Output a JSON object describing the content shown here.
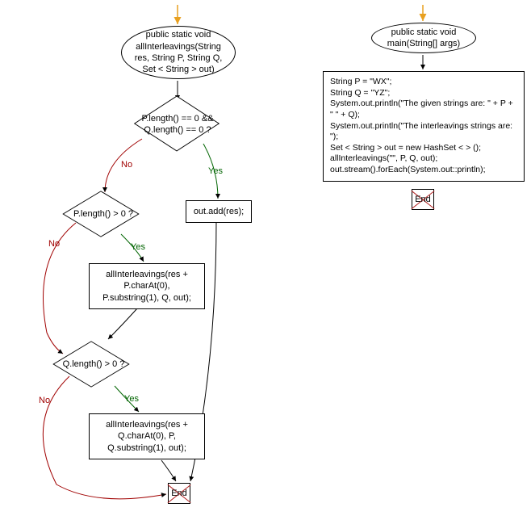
{
  "flow": {
    "func1_sig": "public static void\nallInterleavings(String\nres, String P, String Q,\nSet < String > out)",
    "cond1": "P.length() == 0 &&\nQ.length() == 0 ?",
    "cond2": "P.length() > 0 ?",
    "cond3": "Q.length() > 0 ?",
    "stmt_add": "out.add(res);",
    "rec1": "allInterleavings(res +\nP.charAt(0),\nP.substring(1), Q, out);",
    "rec2": "allInterleavings(res +\nQ.charAt(0), P,\nQ.substring(1), out);",
    "end1": "End",
    "func2_sig": "public static void\nmain(String[] args)",
    "main_body": "String P = \"WX\";\nString Q = \"YZ\";\nSystem.out.println(\"The given strings are: \" + P + \"   \" + Q);\nSystem.out.println(\"The interleavings strings are: \");\nSet < String > out = new HashSet < > ();\nallInterleavings(\"\", P, Q, out);\nout.stream().forEach(System.out::println);",
    "end2": "End",
    "labels": {
      "yes": "Yes",
      "no": "No"
    }
  },
  "chart_data": {
    "type": "flowchart",
    "functions": [
      {
        "name": "allInterleavings",
        "signature": "public static void allInterleavings(String res, String P, String Q, Set<String> out)",
        "nodes": [
          {
            "id": "start1",
            "type": "terminator",
            "text": "public static void allInterleavings(String res, String P, String Q, Set < String > out)"
          },
          {
            "id": "d1",
            "type": "decision",
            "text": "P.length() == 0 && Q.length() == 0 ?"
          },
          {
            "id": "p_add",
            "type": "process",
            "text": "out.add(res);"
          },
          {
            "id": "d2",
            "type": "decision",
            "text": "P.length() > 0 ?"
          },
          {
            "id": "p_rec1",
            "type": "process",
            "text": "allInterleavings(res + P.charAt(0), P.substring(1), Q, out);"
          },
          {
            "id": "d3",
            "type": "decision",
            "text": "Q.length() > 0 ?"
          },
          {
            "id": "p_rec2",
            "type": "process",
            "text": "allInterleavings(res + Q.charAt(0), P, Q.substring(1), out);"
          },
          {
            "id": "end1",
            "type": "end",
            "text": "End"
          }
        ],
        "edges": [
          {
            "from": "start1",
            "to": "d1"
          },
          {
            "from": "d1",
            "to": "p_add",
            "label": "Yes"
          },
          {
            "from": "d1",
            "to": "d2",
            "label": "No"
          },
          {
            "from": "p_add",
            "to": "end1"
          },
          {
            "from": "d2",
            "to": "p_rec1",
            "label": "Yes"
          },
          {
            "from": "d2",
            "to": "d3",
            "label": "No"
          },
          {
            "from": "p_rec1",
            "to": "d3"
          },
          {
            "from": "d3",
            "to": "p_rec2",
            "label": "Yes"
          },
          {
            "from": "d3",
            "to": "end1",
            "label": "No"
          },
          {
            "from": "p_rec2",
            "to": "end1"
          }
        ]
      },
      {
        "name": "main",
        "signature": "public static void main(String[] args)",
        "nodes": [
          {
            "id": "start2",
            "type": "terminator",
            "text": "public static void main(String[] args)"
          },
          {
            "id": "body",
            "type": "process",
            "text": "String P = \"WX\"; String Q = \"YZ\"; System.out.println(\"The given strings are: \" + P + \"   \" + Q); System.out.println(\"The interleavings strings are: \"); Set < String > out = new HashSet < > (); allInterleavings(\"\", P, Q, out); out.stream().forEach(System.out::println);"
          },
          {
            "id": "end2",
            "type": "end",
            "text": "End"
          }
        ],
        "edges": [
          {
            "from": "start2",
            "to": "body"
          },
          {
            "from": "body",
            "to": "end2"
          }
        ]
      }
    ]
  }
}
